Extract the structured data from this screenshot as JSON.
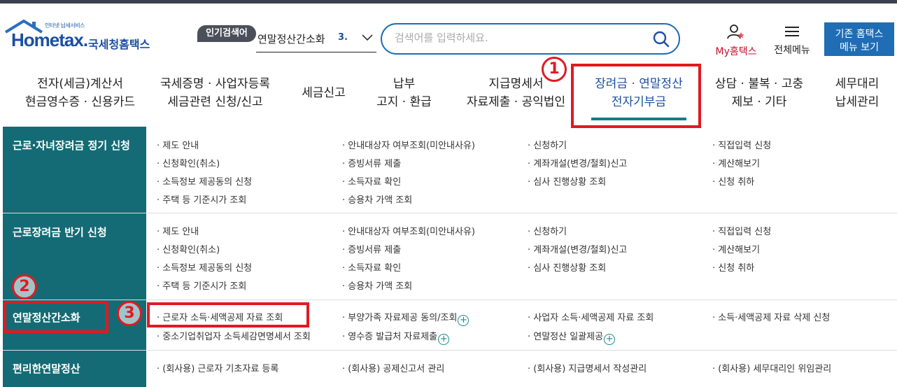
{
  "header": {
    "logo_tagline": "인터넷 납세서비스",
    "logo_text": "Hometax.",
    "logo_kr": "국세청홈택스",
    "popular_badge": "인기검색어",
    "popular_keyword": "연말정산간소화",
    "popular_rank": "3.",
    "search_placeholder": "검색어를 입력하세요.",
    "my_hometax": "My홈택스",
    "all_menu": "전체메뉴",
    "legacy_button": "기존 홈택스\n메뉴 보기"
  },
  "gnb": [
    {
      "label": "전자(세금)계산서\n현금영수증 · 신용카드"
    },
    {
      "label": "국세증명 · 사업자등록\n세금관련 신청/신고"
    },
    {
      "label": "세금신고"
    },
    {
      "label": "납부\n고지 · 환급"
    },
    {
      "label": "지급명세서\n자료제출 · 공익법인"
    },
    {
      "label": "장려금 · 연말정산\n전자기부금",
      "active": true
    },
    {
      "label": "상담 · 불복 · 고충\n제보 · 기타"
    },
    {
      "label": "세무대리\n납세관리"
    }
  ],
  "menu_rows": [
    {
      "title": "근로·자녀장려금 정기 신청",
      "links": [
        "· 제도 안내",
        "· 안내대상자 여부조회(미안내사유)",
        "· 신청하기",
        "· 직접입력 신청",
        "· 신청확인(취소)",
        "· 증빙서류 제출",
        "· 계좌개설(변경/철회)신고",
        "· 계산해보기",
        "· 소득정보 제공동의 신청",
        "· 소득자료 확인",
        "· 심사 진행상황 조회",
        "· 신청 취하",
        "· 주택 등 기준시가 조회",
        "· 승용차 가액 조회"
      ]
    },
    {
      "title": "근로장려금 반기 신청",
      "links": [
        "· 제도 안내",
        "· 안내대상자 여부조회(미안내사유)",
        "· 신청하기",
        "· 직접입력 신청",
        "· 신청확인(취소)",
        "· 증빙서류 제출",
        "· 계좌개설(변경/철회)신고",
        "· 계산해보기",
        "· 소득정보 제공동의 신청",
        "· 소득자료 확인",
        "· 심사 진행상황 조회",
        "· 신청 취하",
        "· 주택 등 기준시가 조회",
        "· 승용차 가액 조회"
      ]
    },
    {
      "title": "연말정산간소화",
      "links": [
        "· 근로자 소득·세액공제 자료 조회",
        "· 부양가족 자료제공 동의/조회",
        "· 사업자 소득·세액공제 자료 조회",
        "· 소득·세액공제 자료 삭제 신청",
        "· 중소기업취업자 소득세감면명세서 조회",
        "· 영수증 발급처 자료제출",
        "· 연말정산 일괄제공"
      ]
    },
    {
      "title": "편리한연말정산",
      "links": [
        "· (회사용) 근로자 기초자료 등록",
        "· (회사용) 공제신고서 관리",
        "· (회사용) 지급명세서 작성관리",
        "· (회사용) 세무대리인 위임관리"
      ]
    }
  ],
  "annotations": [
    "1",
    "2",
    "3"
  ],
  "colors": {
    "brand_blue": "#1c4fa0",
    "teal": "#156b75",
    "annotation_red": "#e01a22"
  }
}
